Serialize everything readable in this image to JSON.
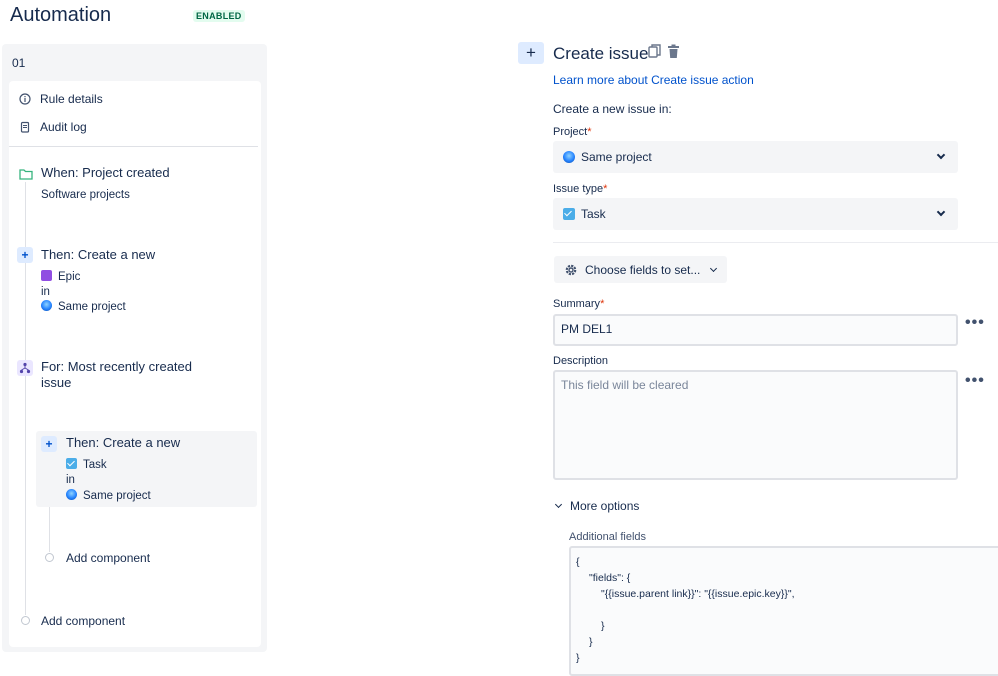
{
  "header": {
    "title": "Automation",
    "status_badge": "ENABLED"
  },
  "rule": {
    "name": "01"
  },
  "left_menu": {
    "rule_details": "Rule details",
    "audit_log": "Audit log"
  },
  "components": {
    "trigger": {
      "title": "When: Project created",
      "sub": "Software projects"
    },
    "action1": {
      "title": "Then: Create a new",
      "issue_type": "Epic",
      "in": "in",
      "project": "Same project"
    },
    "branch": {
      "title_line1": "For: Most recently created",
      "title_line2": "issue"
    },
    "action2": {
      "title": "Then: Create a new",
      "issue_type": "Task",
      "in": "in",
      "project": "Same project"
    },
    "add_component_inner": "Add component",
    "add_component_outer": "Add component"
  },
  "editor": {
    "title": "Create issue",
    "learn_link": "Learn more about Create issue action",
    "intro": "Create a new issue in:",
    "project_label": "Project",
    "project_value": "Same project",
    "issue_type_label": "Issue type",
    "issue_type_value": "Task",
    "choose_fields": "Choose fields to set...",
    "summary_label": "Summary",
    "summary_value": "PM DEL1",
    "description_label": "Description",
    "description_placeholder": "This field will be cleared",
    "more_options": "More options",
    "additional_fields_label": "Additional fields",
    "code_lines": [
      "{",
      "\"fields\": {",
      "\"{{issue.parent link}}\": \"{{issue.epic.key}}\",",
      "}",
      "}",
      "}"
    ]
  },
  "colors": {
    "accent": "#0052cc",
    "badge_green": "#006644",
    "required": "#de350b",
    "panel_bg": "#f4f5f7"
  },
  "icons": [
    "info-icon",
    "clipboard-icon",
    "folder-icon",
    "plus-icon",
    "branch-icon",
    "copy-icon",
    "trash-icon",
    "gear-icon",
    "chevron-down-icon",
    "more-icon"
  ]
}
